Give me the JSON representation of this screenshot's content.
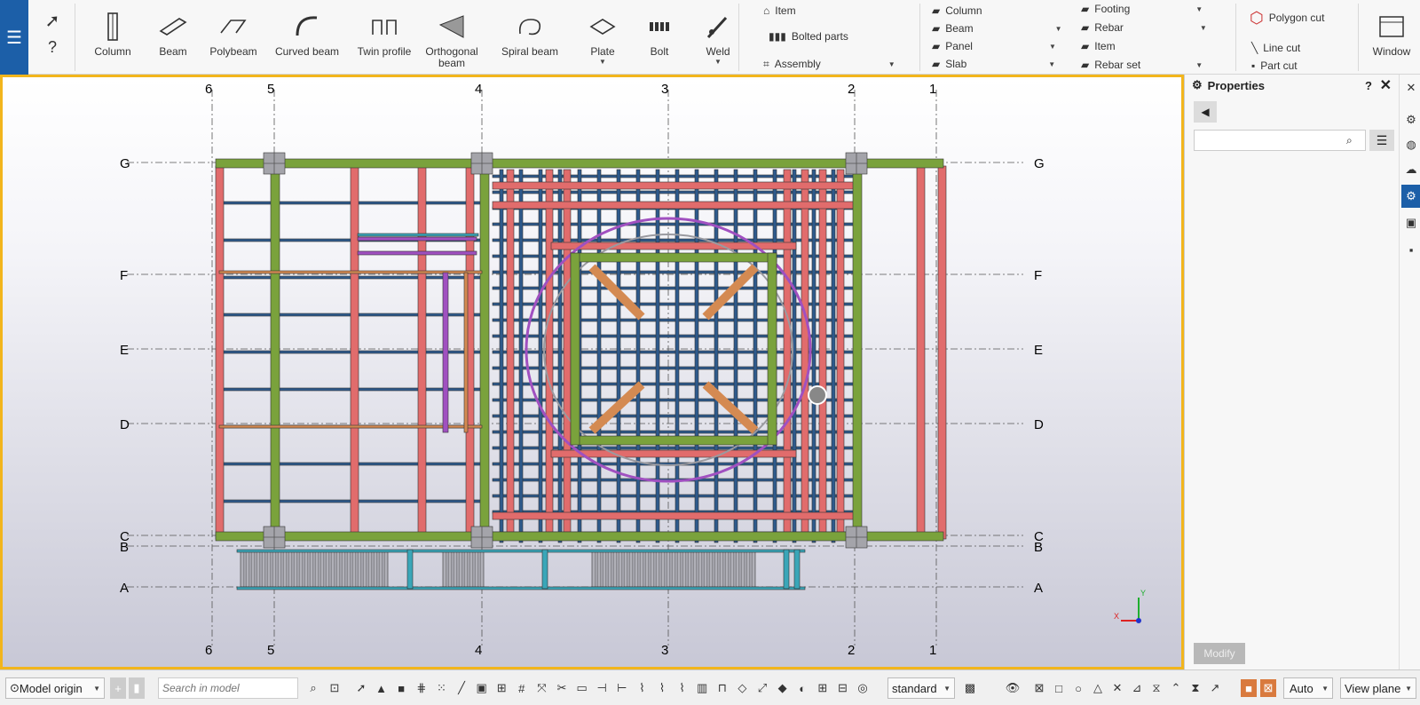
{
  "ribbon": {
    "menu_icon": "hamburger-icon",
    "tools": [
      {
        "label": "Column",
        "icon": "column-icon"
      },
      {
        "label": "Beam",
        "icon": "beam-icon"
      },
      {
        "label": "Polybeam",
        "icon": "polybeam-icon"
      },
      {
        "label": "Curved beam",
        "icon": "curved-beam-icon"
      },
      {
        "label": "Twin profile",
        "icon": "twin-profile-icon"
      },
      {
        "label": "Orthogonal beam",
        "icon": "orthogonal-beam-icon"
      },
      {
        "label": "Spiral beam",
        "icon": "spiral-beam-icon"
      },
      {
        "label": "Plate",
        "icon": "plate-icon"
      },
      {
        "label": "Bolt",
        "icon": "bolt-icon"
      },
      {
        "label": "Weld",
        "icon": "weld-icon"
      }
    ],
    "detailing": {
      "item": "Item",
      "bolted_parts": "Bolted parts",
      "assembly": "Assembly"
    },
    "concrete_col1": [
      "Column",
      "Beam",
      "Panel",
      "Slab"
    ],
    "concrete_col2": [
      "Footing",
      "Rebar",
      "Item",
      "Rebar set"
    ],
    "cuts": {
      "polygon": "Polygon cut",
      "line": "Line cut",
      "part": "Part cut"
    },
    "window_label": "Window"
  },
  "viewport": {
    "grid_x": [
      "6",
      "5",
      "4",
      "3",
      "2",
      "1"
    ],
    "grid_y": [
      "G",
      "F",
      "E",
      "D",
      "C",
      "B",
      "A"
    ],
    "colors": {
      "frame": "#7aa23c",
      "red": "#e16c6c",
      "blue": "#2e5a8c",
      "orange": "#d48a52",
      "purple": "#a050c0",
      "grey": "#9a9aa0",
      "teal": "#3aa6b8"
    }
  },
  "properties": {
    "title": "Properties",
    "search_placeholder": "",
    "modify_label": "Modify"
  },
  "statusbar": {
    "origin": "Model origin",
    "search_placeholder": "Search in model",
    "representation": "standard",
    "snap": "Auto",
    "view_plane": "View plane"
  }
}
